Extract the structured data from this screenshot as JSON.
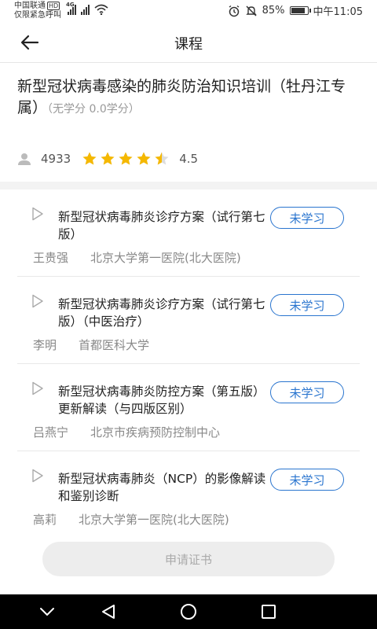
{
  "status_bar": {
    "carrier_line1": "中国联通",
    "carrier_badge": "HD",
    "carrier_line2": "仅限紧急呼叫",
    "network_label": "4G",
    "battery_percent": "85%",
    "battery_level": 0.85,
    "time": "中午11:05"
  },
  "header": {
    "title": "课程"
  },
  "course": {
    "title": "新型冠状病毒感染的肺炎防治知识培训（牡丹江专属）",
    "credit": "（无学分 0.0学分）",
    "learner_count": "4933",
    "rating": "4.5",
    "rating_value": 4.5,
    "rating_max": 5
  },
  "lessons": [
    {
      "title": "新型冠状病毒肺炎诊疗方案（试行第七版）",
      "status": "未学习",
      "author": "王贵强",
      "institution": "北京大学第一医院(北大医院)"
    },
    {
      "title": "新型冠状病毒肺炎诊疗方案（试行第七版）（中医治疗）",
      "status": "未学习",
      "author": "李明",
      "institution": "首都医科大学"
    },
    {
      "title": "新型冠状病毒肺炎防控方案（第五版）更新解读（与四版区别）",
      "status": "未学习",
      "author": "吕燕宁",
      "institution": "北京市疾病预防控制中心"
    },
    {
      "title": "新型冠状病毒肺炎（NCP）的影像解读和鉴别诊断",
      "status": "未学习",
      "author": "高莉",
      "institution": "北京大学第一医院(北大医院)"
    }
  ],
  "footer": {
    "apply_label": "申请证书"
  },
  "colors": {
    "accent": "#2a75cf",
    "star": "#f5b800"
  }
}
